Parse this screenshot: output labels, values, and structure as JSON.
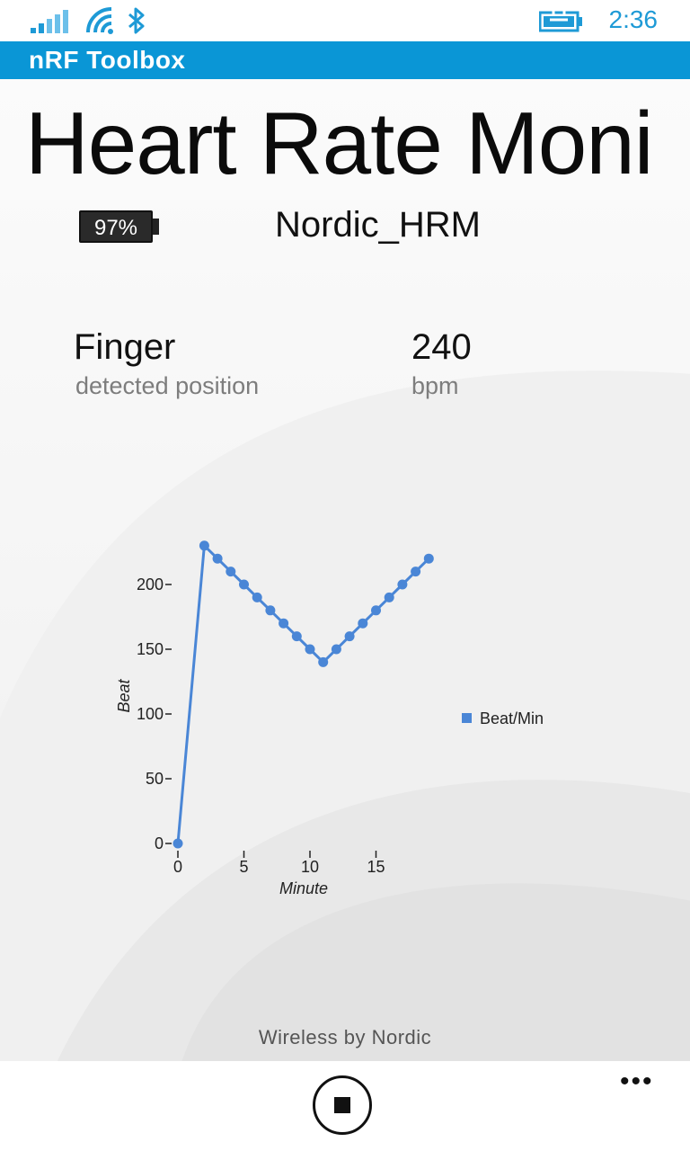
{
  "status_bar": {
    "time": "2:36",
    "icons": [
      "signal-icon",
      "wifi-icon",
      "bluetooth-icon",
      "battery-charging-icon"
    ],
    "accent_color": "#1e9ad6"
  },
  "app_bar": {
    "title": "nRF Toolbox",
    "color": "#0a96d6"
  },
  "page": {
    "title": "Heart Rate Moni",
    "battery_level": "97%",
    "device_name": "Nordic_HRM"
  },
  "stats": {
    "position_value": "Finger",
    "position_label": "detected position",
    "rate_value": "240",
    "rate_label": "bpm"
  },
  "chart_data": {
    "type": "line",
    "xlabel": "Minute",
    "ylabel": "Beat",
    "xlim": [
      0,
      19
    ],
    "ylim": [
      0,
      240
    ],
    "x_ticks": [
      "0",
      "5",
      "10",
      "15"
    ],
    "y_ticks": [
      "0",
      "50",
      "100",
      "150",
      "200"
    ],
    "legend_position": "right",
    "series": [
      {
        "name": "Beat/Min",
        "color": "#4a86d6",
        "x": [
          0,
          2,
          3,
          4,
          5,
          6,
          7,
          8,
          9,
          10,
          11,
          12,
          13,
          14,
          15,
          16,
          17,
          18,
          19
        ],
        "values": [
          0,
          230,
          220,
          210,
          200,
          190,
          180,
          170,
          160,
          150,
          140,
          150,
          160,
          170,
          180,
          190,
          200,
          210,
          220
        ]
      }
    ]
  },
  "footer": {
    "text": "Wireless by Nordic"
  },
  "bottom_bar": {
    "stop_icon": "stop-icon",
    "more_label": "•••"
  }
}
